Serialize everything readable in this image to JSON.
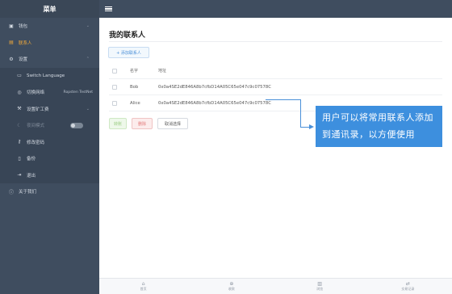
{
  "sidebar": {
    "title": "菜单",
    "items": [
      {
        "icon": "wallet-icon",
        "glyph": "▣",
        "label": "钱包",
        "chevron": "⌄"
      },
      {
        "icon": "contacts-icon",
        "glyph": "▤",
        "label": "联系人",
        "active": true
      },
      {
        "icon": "settings-icon",
        "glyph": "⚙",
        "label": "设置",
        "chevron": "⌃"
      },
      {
        "icon": "language-icon",
        "glyph": "▭",
        "label": "Switch Language"
      },
      {
        "icon": "network-icon",
        "glyph": "◎",
        "label": "切换网络",
        "note": "Ropsten TestNet"
      },
      {
        "icon": "mining-icon",
        "glyph": "⚒",
        "label": "设置矿工费",
        "chevron": "⌄"
      },
      {
        "icon": "moon-icon",
        "glyph": "☾",
        "label": "夜间模式",
        "toggle": true
      },
      {
        "icon": "key-icon",
        "glyph": "⚷",
        "label": "修改密码"
      },
      {
        "icon": "backup-icon",
        "glyph": "▯",
        "label": "备份"
      },
      {
        "icon": "logout-icon",
        "glyph": "⇥",
        "label": "退出"
      },
      {
        "icon": "info-icon",
        "glyph": "ⓘ",
        "label": "关于我们"
      }
    ]
  },
  "main": {
    "title": "我的联系人",
    "add_label": "+ 添加联系人",
    "table": {
      "headers": [
        "名字",
        "地址"
      ],
      "rows": [
        {
          "name": "Bob",
          "address": "0x0a4SE2dE846A8b7cfbD14A05C65e047c9c07578C"
        },
        {
          "name": "Alice",
          "address": "0x0a4SE2dE846A8b7cfbD14A05C65e047c9c07578C"
        }
      ]
    },
    "actions": {
      "send": "转账",
      "delete": "删除",
      "cancel": "取消选择"
    }
  },
  "callout": {
    "text": "用户可以将常用联系人添加到通讯录，以方便使用"
  },
  "bottom_nav": [
    {
      "icon": "home-icon",
      "glyph": "⌂",
      "label": "首页"
    },
    {
      "icon": "receive-icon",
      "glyph": "⊕",
      "label": "收款"
    },
    {
      "icon": "browser-icon",
      "glyph": "▥",
      "label": "浏览"
    },
    {
      "icon": "history-icon",
      "glyph": "⇄",
      "label": "交易记录"
    }
  ]
}
